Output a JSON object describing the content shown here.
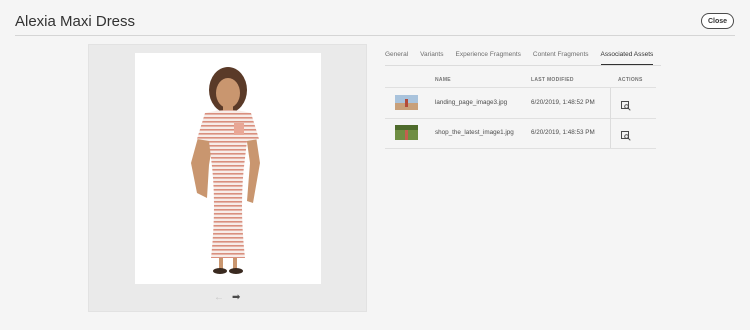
{
  "header": {
    "title": "Alexia Maxi Dress",
    "close_label": "Close"
  },
  "preview": {
    "image_icon": "dress-product-photo",
    "prev_icon": "arrow-left-icon",
    "next_icon": "arrow-right-icon",
    "prev_glyph": "←",
    "next_glyph": "➡"
  },
  "tabs": [
    {
      "label": "General",
      "active": false
    },
    {
      "label": "Variants",
      "active": false
    },
    {
      "label": "Experience Fragments",
      "active": false
    },
    {
      "label": "Content Fragments",
      "active": false
    },
    {
      "label": "Associated Assets",
      "active": true
    }
  ],
  "table": {
    "columns": {
      "name": "NAME",
      "modified": "LAST MODIFIED",
      "actions": "ACTIONS"
    },
    "rows": [
      {
        "name": "landing_page_image3.jpg",
        "modified": "6/20/2019, 1:48:52 PM",
        "action_icon": "asset-view-icon"
      },
      {
        "name": "shop_the_latest_image1.jpg",
        "modified": "6/20/2019, 1:48:53 PM",
        "action_icon": "asset-view-icon"
      }
    ]
  },
  "colors": {
    "accent": "#323232",
    "panel": "#eaeaea",
    "background": "#f5f5f5"
  }
}
